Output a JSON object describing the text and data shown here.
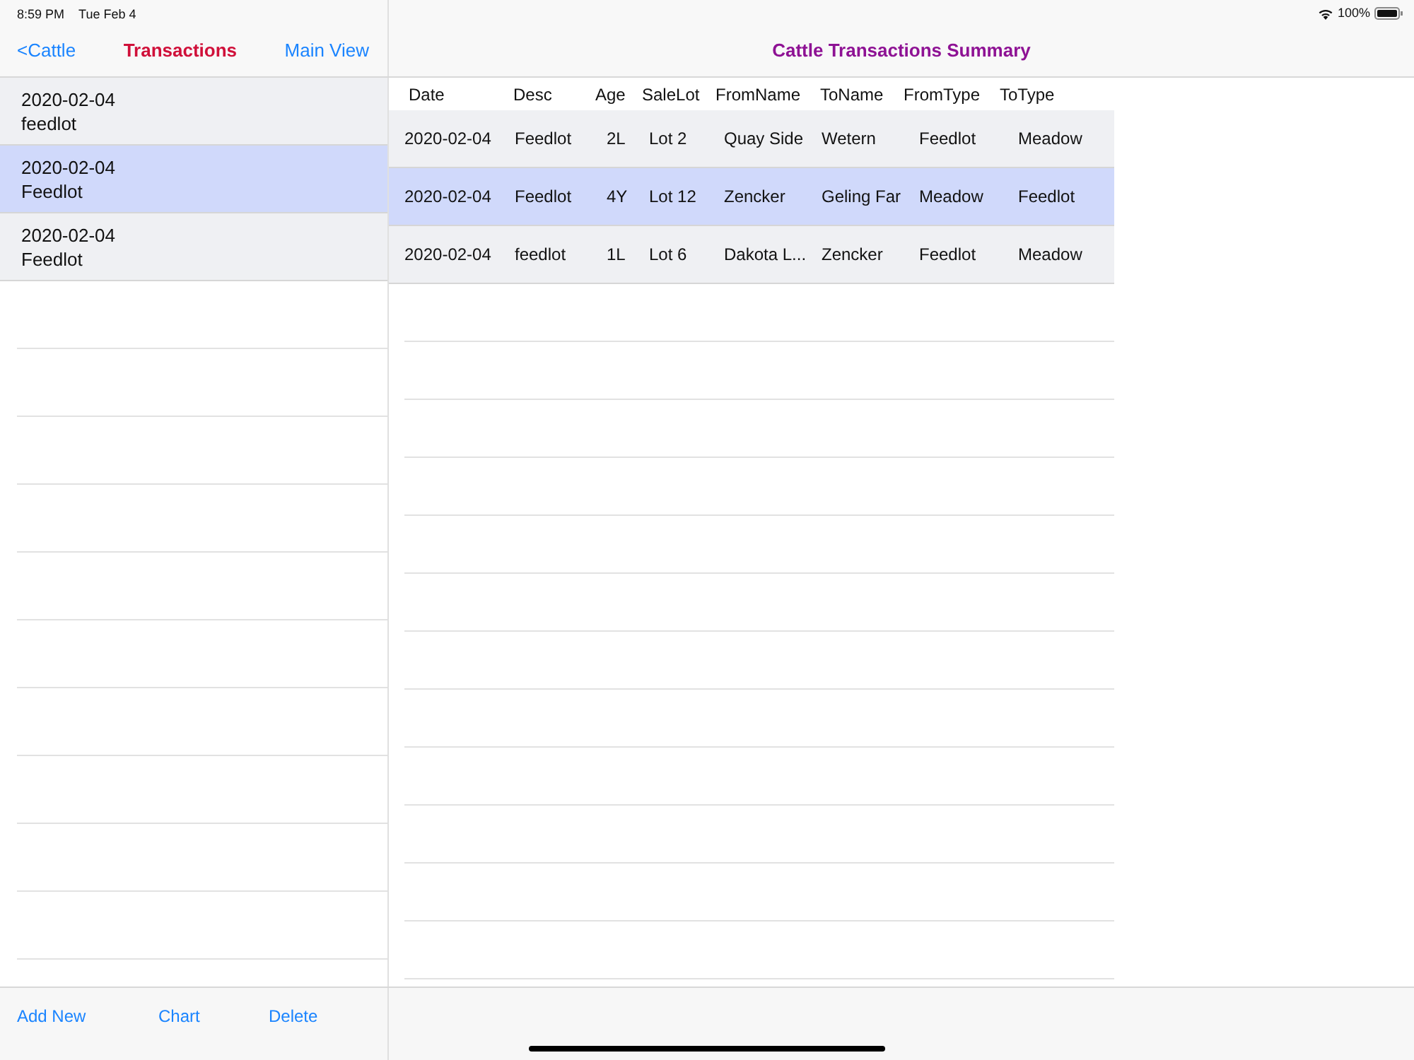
{
  "status_bar": {
    "time": "8:59 PM",
    "date": "Tue Feb 4",
    "battery": "100%"
  },
  "sidebar": {
    "back": "<Cattle",
    "title": "Transactions",
    "action": "Main View",
    "items": [
      {
        "date": "2020-02-04",
        "desc": "feedlot",
        "selected": false
      },
      {
        "date": "2020-02-04",
        "desc": "Feedlot",
        "selected": true
      },
      {
        "date": "2020-02-04",
        "desc": "Feedlot",
        "selected": false
      }
    ],
    "toolbar": [
      "Add New",
      "Chart",
      "Delete"
    ]
  },
  "detail": {
    "title": "Cattle Transactions Summary",
    "table": {
      "columns": [
        "Date",
        "Desc",
        "Age",
        "SaleLot",
        "FromName",
        "ToName",
        "FromType",
        "ToType"
      ],
      "rows": [
        {
          "cells": [
            "2020-02-04",
            "Feedlot",
            "2L",
            "Lot 2",
            "Quay Side",
            "Wetern",
            "Feedlot",
            "Meadow"
          ],
          "selected": false
        },
        {
          "cells": [
            "2020-02-04",
            "Feedlot",
            "4Y",
            "Lot 12",
            "Zencker",
            "Geling Far",
            "Meadow",
            "Feedlot"
          ],
          "selected": true
        },
        {
          "cells": [
            "2020-02-04",
            "feedlot",
            "1L",
            "Lot 6",
            "Dakota L...",
            "Zencker",
            "Feedlot",
            "Meadow"
          ],
          "selected": false
        }
      ]
    }
  }
}
